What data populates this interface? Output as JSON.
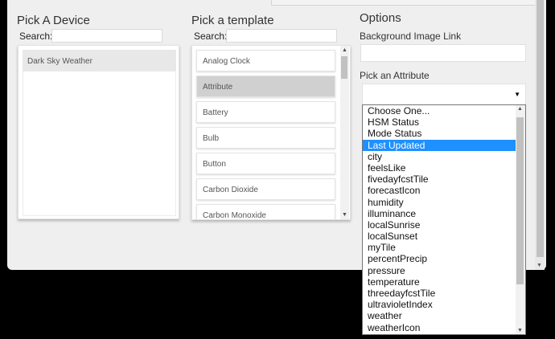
{
  "device_column": {
    "title": "Pick A Device",
    "search_label": "Search:",
    "search_value": "",
    "devices": [
      "Dark Sky Weather"
    ]
  },
  "template_column": {
    "title": "Pick a template",
    "search_label": "Search:",
    "search_value": "",
    "templates": [
      "Analog Clock",
      "Attribute",
      "Battery",
      "Bulb",
      "Button",
      "Carbon Dioxide",
      "Carbon Monoxide"
    ],
    "selected_template": "Attribute"
  },
  "options": {
    "title": "Options",
    "bg_image_label": "Background Image Link",
    "bg_image_value": "",
    "attribute_label": "Pick an Attribute",
    "attribute_selected": "",
    "attribute_options": [
      "Choose One...",
      "HSM Status",
      "Mode Status",
      "Last Updated",
      "city",
      "feelsLike",
      "fivedayfcstTile",
      "forecastIcon",
      "humidity",
      "illuminance",
      "localSunrise",
      "localSunset",
      "myTile",
      "percentPrecip",
      "pressure",
      "temperature",
      "threedayfcstTile",
      "ultravioletIndex",
      "weather",
      "weatherIcon"
    ],
    "attribute_highlighted": "Last Updated"
  },
  "icons": {
    "select_caret": "caret-down-icon",
    "scroll_up": "scroll-up-arrow-icon",
    "scroll_down": "scroll-down-arrow-icon"
  },
  "colors": {
    "highlight": "#1e90ff",
    "selected_template": "#d0d0d0",
    "panel_bg": "#efefef"
  }
}
